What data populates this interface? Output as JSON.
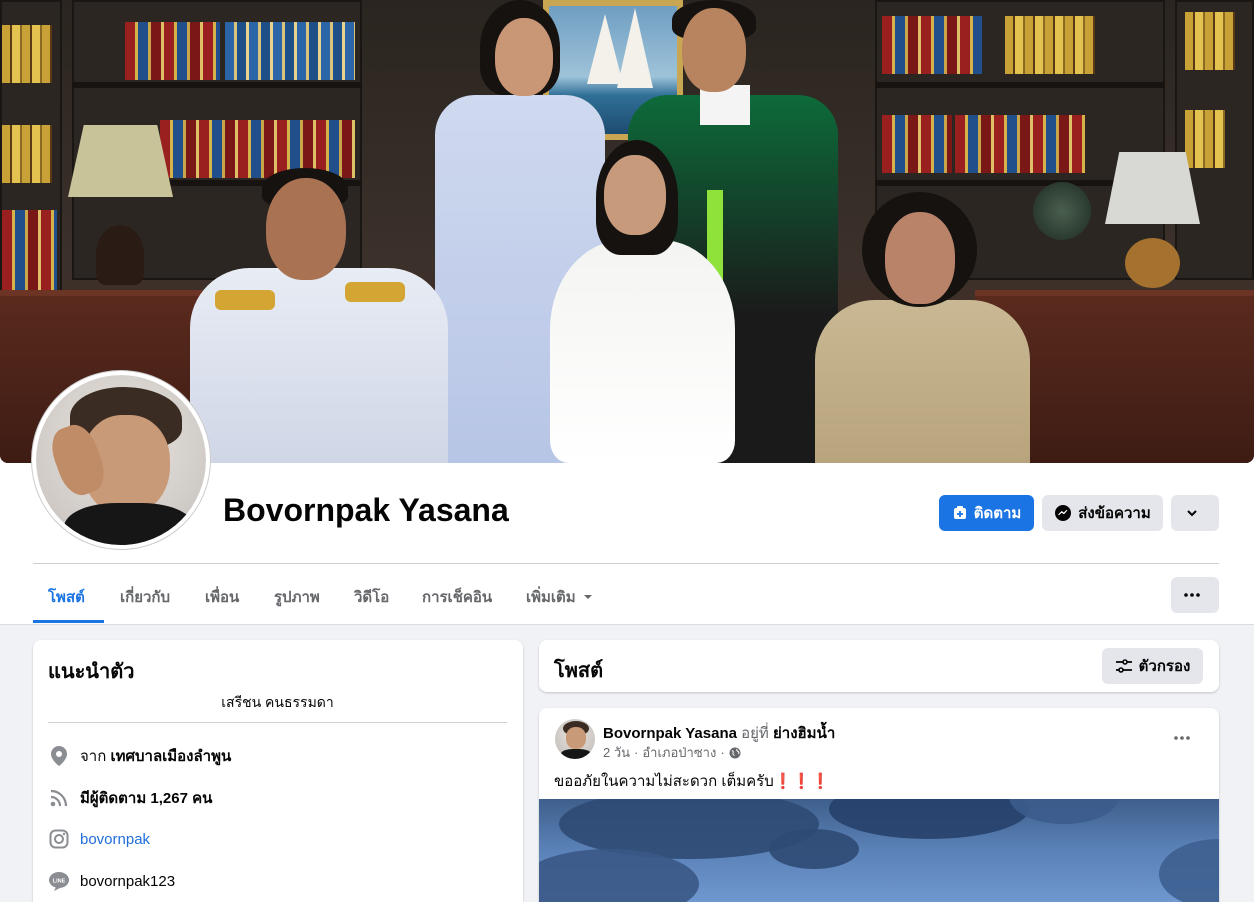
{
  "profile": {
    "name": "Bovornpak Yasana"
  },
  "actions": {
    "follow_label": "ติดตาม",
    "message_label": "ส่งข้อความ"
  },
  "tabs": [
    {
      "label": "โพสต์"
    },
    {
      "label": "เกี่ยวกับ"
    },
    {
      "label": "เพื่อน"
    },
    {
      "label": "รูปภาพ"
    },
    {
      "label": "วิดีโอ"
    },
    {
      "label": "การเช็คอิน"
    },
    {
      "label": "เพิ่มเติม"
    }
  ],
  "intro": {
    "title": "แนะนำตัว",
    "bio": "เสรีชน คนธรรมดา",
    "from_prefix": "จาก",
    "from_place": "เทศบาลเมืองลำพูน",
    "followers_text": "มีผู้ติดตาม 1,267 คน",
    "instagram": "bovornpak",
    "line": "bovornpak123"
  },
  "posts_header": {
    "title": "โพสต์",
    "filter_label": "ตัวกรอง"
  },
  "post": {
    "author": "Bovornpak Yasana",
    "at_prefix": "อยู่ที่",
    "location": "ย่างฮิมน้ำ",
    "time": "2 วัน",
    "place": "อำเภอป่าซาง",
    "separator": "·",
    "text": "ขออภัยในความไม่สะดวก เต็มครับ",
    "emoji": "❗❗❗"
  },
  "colors": {
    "accent": "#1b74e4",
    "page_bg": "#f0f2f5",
    "link": "#216fdb"
  }
}
